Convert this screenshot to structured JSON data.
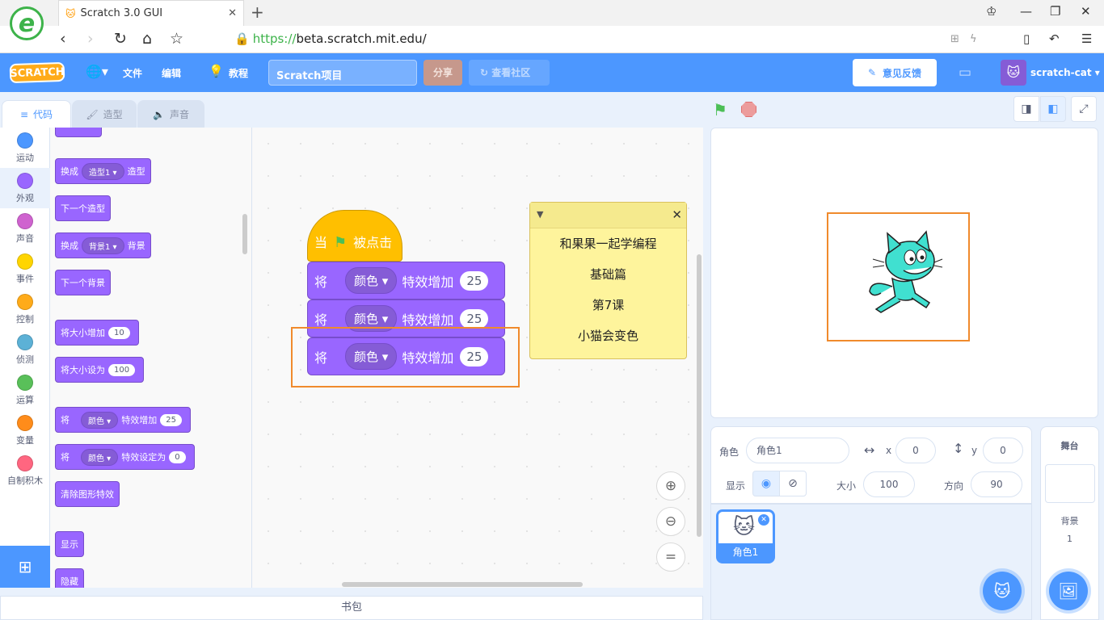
{
  "browser": {
    "tab_title": "Scratch 3.0 GUI",
    "url_prefix": "https://",
    "url_host": "beta.scratch.mit.edu",
    "url_path": "/",
    "logo_letter": "e"
  },
  "menubar": {
    "logo_text": "SCRATCH",
    "file": "文件",
    "edit": "编辑",
    "tutorials": "教程",
    "project_title": "Scratch项目",
    "share": "分享",
    "see_community": "查看社区",
    "feedback": "意见反馈",
    "username": "scratch-cat"
  },
  "editor_tabs": [
    "代码",
    "造型",
    "声音"
  ],
  "categories": [
    {
      "label": "运动",
      "color": "#4c97ff"
    },
    {
      "label": "外观",
      "color": "#9966ff"
    },
    {
      "label": "声音",
      "color": "#cf63cf"
    },
    {
      "label": "事件",
      "color": "#ffd500"
    },
    {
      "label": "控制",
      "color": "#ffab19"
    },
    {
      "label": "侦测",
      "color": "#5cb1d6"
    },
    {
      "label": "运算",
      "color": "#59c059"
    },
    {
      "label": "变量",
      "color": "#ff8c1a"
    },
    {
      "label": "自制积木",
      "color": "#ff6680"
    }
  ],
  "palette": {
    "switch_costume": {
      "pre": "换成",
      "menu": "造型1",
      "post": "造型"
    },
    "next_costume": "下一个造型",
    "switch_backdrop": {
      "pre": "换成",
      "menu": "背景1",
      "post": "背景"
    },
    "next_backdrop": "下一个背景",
    "change_size": {
      "text": "将大小增加",
      "value": "10"
    },
    "set_size": {
      "text": "将大小设为",
      "value": "100"
    },
    "change_effect": {
      "pre": "将",
      "menu": "颜色",
      "post": "特效增加",
      "value": "25"
    },
    "set_effect": {
      "pre": "将",
      "menu": "颜色",
      "post": "特效设定为",
      "value": "0"
    },
    "clear_effects": "清除图形特效",
    "show": "显示",
    "hide": "隐藏"
  },
  "script": {
    "hat_pre": "当",
    "hat_post": "被点击",
    "blocks": [
      {
        "pre": "将",
        "menu": "颜色",
        "post": "特效增加",
        "value": "25"
      },
      {
        "pre": "将",
        "menu": "颜色",
        "post": "特效增加",
        "value": "25"
      },
      {
        "pre": "将",
        "menu": "颜色",
        "post": "特效增加",
        "value": "25"
      }
    ]
  },
  "note": {
    "lines": [
      "和果果一起学编程",
      "基础篇",
      "第7课",
      "小猫会变色"
    ]
  },
  "backpack": "书包",
  "sprite_info": {
    "sprite_label": "角色",
    "sprite_name": "角色1",
    "x_label": "x",
    "x": "0",
    "y_label": "y",
    "y": "0",
    "show_label": "显示",
    "size_label": "大小",
    "size": "100",
    "direction_label": "方向",
    "direction": "90"
  },
  "sprites": [
    {
      "name": "角色1"
    }
  ],
  "stage_pane": {
    "title": "舞台",
    "backdrop_label": "背景",
    "backdrop_count": "1"
  }
}
